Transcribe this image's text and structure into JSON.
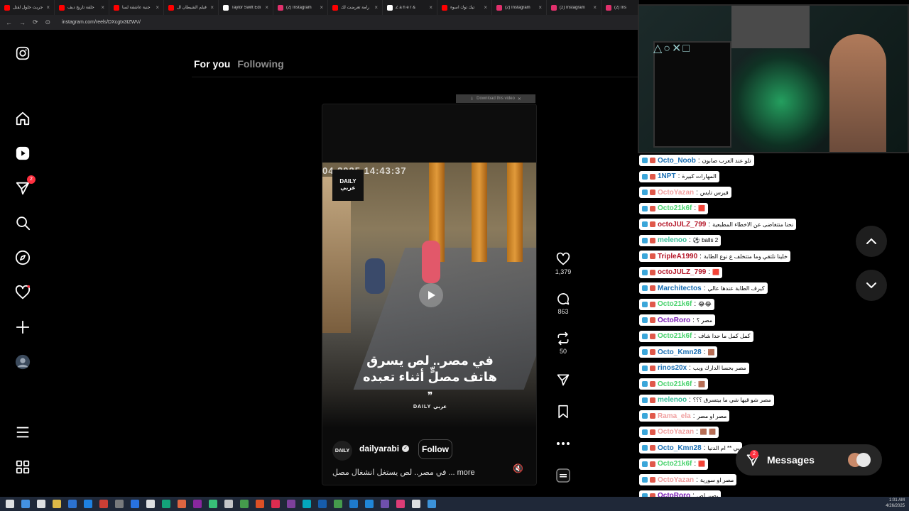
{
  "browser": {
    "tabs": [
      {
        "title": "جربت حلول لقتل",
        "color": "#ff0000"
      },
      {
        "title": "حلقة تاريخ ديف",
        "color": "#ff0000"
      },
      {
        "title": "جنية عاشقة لسا",
        "color": "#ff0000"
      },
      {
        "title": "فيلم الشيطان ال",
        "color": "#ff0000"
      },
      {
        "title": "Taylor Swift Edi",
        "color": "#ffffff"
      },
      {
        "title": "(2) Instagram",
        "color": "#e1306c"
      },
      {
        "title": "رامة تعرضت لك",
        "color": "#ff0000"
      },
      {
        "title": "Z a h e r &",
        "color": "#ffffff"
      },
      {
        "title": "تيك توك اسوء",
        "color": "#ff0000"
      },
      {
        "title": "(2) Instagram",
        "color": "#e1306c"
      },
      {
        "title": "(2) Instagram",
        "color": "#e1306c"
      },
      {
        "title": "(2) Ins",
        "color": "#e1306c"
      }
    ],
    "url": "instagram.com/reels/DXcgtx3tZWV/"
  },
  "sidebar": {
    "icons": [
      "instagram-logo-icon",
      "home-icon",
      "reels-icon",
      "direct-messages-icon",
      "search-icon",
      "explore-icon",
      "notifications-icon",
      "create-icon",
      "profile-avatar",
      "more-menu-icon",
      "also-from-meta-icon"
    ],
    "messages_badge": "2"
  },
  "feed": {
    "tab_foryou": "For you",
    "tab_following": "Following"
  },
  "reel": {
    "download_label": "Download this video",
    "timestamp": "04 2025 14:43:37",
    "logo_top": "DAILY",
    "logo_bottom": "عربي",
    "caption_line1": "في مصر.. لص يسرق",
    "caption_line2": "هاتف مصلٍّ أثناء تعبده",
    "quote_mark": "❞",
    "watermark": "DAILY عربي",
    "author": "dailyarabi",
    "verified_mark": "✓",
    "follow_label": "Follow",
    "post_caption": "في مصر.. لص يستغل انشغال مصلٍ ... more",
    "mute_icon": "🔇"
  },
  "actions": {
    "likes": "1,379",
    "comments": "863",
    "reposts": "50"
  },
  "chat": [
    {
      "user": "Octo_Noob",
      "msg": "تلو عند العرب صابون",
      "color": "#1b6fb3"
    },
    {
      "user": "1NPT",
      "msg": "المهارات كبيرة",
      "color": "#1b6fb3"
    },
    {
      "user": "OctoYazan",
      "msg": "قيرس تايس",
      "color": "#f0a0a0"
    },
    {
      "user": "Octo21k6f",
      "msg": "🟥",
      "color": "#4ad36e"
    },
    {
      "user": "octoJULZ_799",
      "msg": "نحنا متتغاضى عن الاخطاء المطبعية",
      "color": "#b5182a"
    },
    {
      "user": "melenoo",
      "msg": "2 balls ⚽",
      "color": "#3bbf9a"
    },
    {
      "user": "TripleA1990",
      "msg": "خلينا نلتقي وما متتخلف ع نوع الطابة",
      "color": "#b5182a"
    },
    {
      "user": "octoJULZ_799",
      "msg": "🟥",
      "color": "#b5182a"
    },
    {
      "user": "Marchitectos",
      "msg": "كيرف الطابة عندها عالي",
      "color": "#1b6fb3"
    },
    {
      "user": "Octo21k6f",
      "msg": "😂😂",
      "color": "#4ad36e"
    },
    {
      "user": "OctoRoro",
      "msg": "مصر ؟",
      "color": "#7a1bb5"
    },
    {
      "user": "Octo21k6f",
      "msg": "كمل كمل ما حدا شاف",
      "color": "#4ad36e"
    },
    {
      "user": "Octo_Kmn28",
      "msg": "🟫",
      "color": "#1b6fb3"
    },
    {
      "user": "rinos20x",
      "msg": "مصر بحسا الدارك ويب",
      "color": "#1b6fb3"
    },
    {
      "user": "Octo21k6f",
      "msg": "🟫",
      "color": "#4ad36e"
    },
    {
      "user": "melenoo",
      "msg": "مصر شو قيها شي ما بيتسرق ؟؟؟",
      "color": "#3bbf9a"
    },
    {
      "user": "Rama_ela",
      "msg": "مصر او مصر",
      "color": "#f0a0a0"
    },
    {
      "user": "OctoYazan",
      "msg": "🟫 🟫",
      "color": "#f0a0a0"
    },
    {
      "user": "Octo_Kmn28",
      "msg": "بي ** ام الدنيا",
      "color": "#1b6fb3"
    },
    {
      "user": "Octo21k6f",
      "msg": "🟥",
      "color": "#4ad36e"
    },
    {
      "user": "OctoYazan",
      "msg": "مصر او سورية",
      "color": "#f0a0a0"
    },
    {
      "user": "OctoRoro",
      "msg": "بصير لص",
      "color": "#7a1bb5"
    }
  ],
  "messages": {
    "label": "Messages",
    "badge": "2"
  },
  "taskbar": {
    "time": "1:01 AM",
    "date": "4/26/2025"
  }
}
